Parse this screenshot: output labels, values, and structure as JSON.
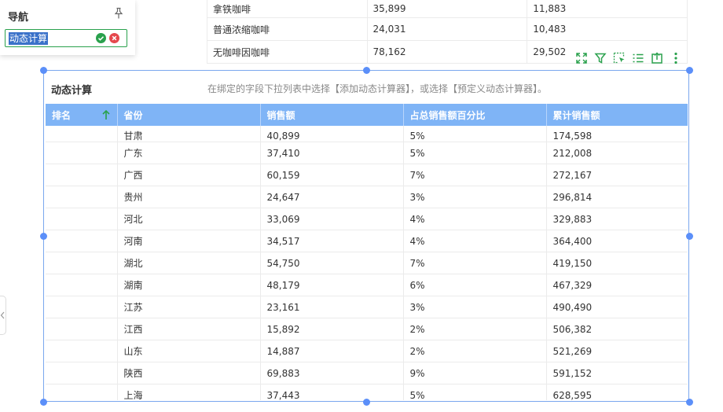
{
  "nav": {
    "title": "导航",
    "edit_value": "动态计算"
  },
  "bg_table": {
    "rows": [
      [
        "拿铁咖啡",
        "35,899",
        "11,883"
      ],
      [
        "普通浓缩咖啡",
        "24,031",
        "10,483"
      ],
      [
        "无咖啡因咖啡",
        "78,162",
        "29,502"
      ]
    ]
  },
  "component": {
    "title": "动态计算",
    "hint": "在绑定的字段下拉列表中选择【添加动态计算器】，或选择【预定义动态计算器】。"
  },
  "table": {
    "headers": [
      "排名",
      "省份",
      "销售额",
      "占总销售额百分比",
      "累计销售额"
    ],
    "rows": [
      [
        "",
        "甘肃",
        "40,899",
        "5%",
        "174,598"
      ],
      [
        "",
        "广东",
        "37,410",
        "5%",
        "212,008"
      ],
      [
        "",
        "广西",
        "60,159",
        "7%",
        "272,167"
      ],
      [
        "",
        "贵州",
        "24,647",
        "3%",
        "296,814"
      ],
      [
        "",
        "河北",
        "33,069",
        "4%",
        "329,883"
      ],
      [
        "",
        "河南",
        "34,517",
        "4%",
        "364,400"
      ],
      [
        "",
        "湖北",
        "54,750",
        "7%",
        "419,150"
      ],
      [
        "",
        "湖南",
        "48,179",
        "6%",
        "467,329"
      ],
      [
        "",
        "江苏",
        "23,161",
        "3%",
        "490,490"
      ],
      [
        "",
        "江西",
        "15,892",
        "2%",
        "506,382"
      ],
      [
        "",
        "山东",
        "14,887",
        "2%",
        "521,269"
      ],
      [
        "",
        "陕西",
        "69,883",
        "9%",
        "591,152"
      ],
      [
        "",
        "上海",
        "37,443",
        "5%",
        "628,595"
      ]
    ]
  },
  "icons": [
    "pin-icon",
    "confirm-icon",
    "cancel-icon",
    "expand-icon",
    "filter-icon",
    "select-icon",
    "list-icon",
    "export-icon",
    "more-icon",
    "sort-asc-icon",
    "chevron-left-icon"
  ],
  "colors": {
    "accent_green": "#2aa14d",
    "header_blue": "#7fb4f6",
    "selection_blue": "#5b8ff9",
    "cancel_red": "#e5484d"
  }
}
